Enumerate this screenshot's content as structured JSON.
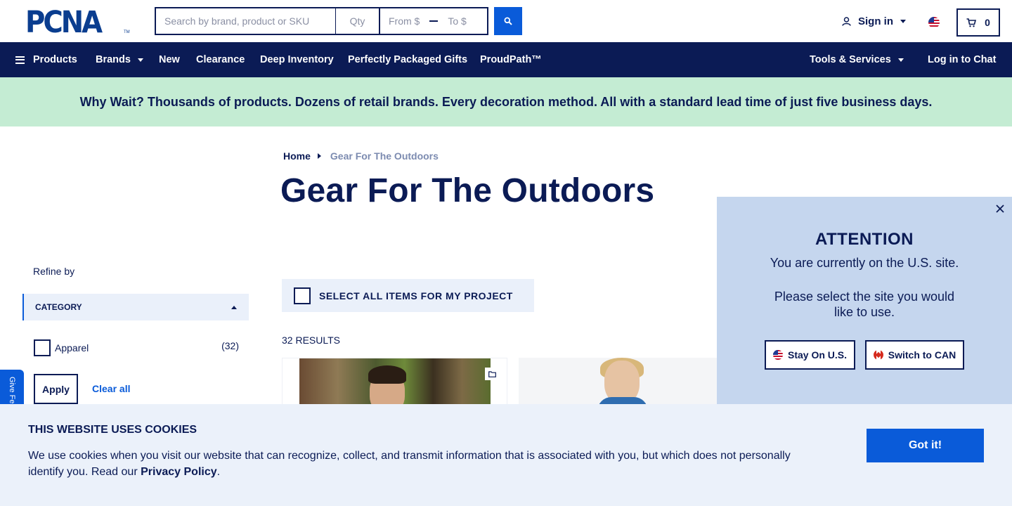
{
  "header": {
    "logo_text": "PCNA",
    "logo_tm": "TM",
    "search_placeholder": "Search by brand, product or SKU",
    "qty_placeholder": "Qty",
    "price_from_placeholder": "From $",
    "price_to_placeholder": "To $",
    "signin_label": "Sign in",
    "cart_count": "0"
  },
  "nav": {
    "products": "Products",
    "brands": "Brands",
    "new": "New",
    "clearance": "Clearance",
    "deep_inventory": "Deep Inventory",
    "gifts": "Perfectly Packaged Gifts",
    "proudpath": "ProudPath™",
    "tools": "Tools & Services",
    "chat": "Log in to Chat"
  },
  "promo": {
    "text": "Why Wait? Thousands of products. Dozens of retail brands. Every decoration method. All with a standard lead time of just five business days."
  },
  "breadcrumb": {
    "home": "Home",
    "current": "Gear For The Outdoors"
  },
  "page": {
    "title": "Gear For The Outdoors",
    "select_all": "SELECT ALL ITEMS FOR MY PROJECT",
    "results": "32 RESULTS"
  },
  "sidebar": {
    "refine_label": "Refine by",
    "category_header": "CATEGORY",
    "facets": [
      {
        "label": "Apparel",
        "count": "(32)"
      }
    ],
    "apply_label": "Apply",
    "clear_label": "Clear all",
    "feedback_label": "Give Feedback"
  },
  "attention": {
    "title": "ATTENTION",
    "message": "You are currently on the U.S. site.",
    "prompt": "Please select the site you would like to use.",
    "stay_label": "Stay On U.S.",
    "switch_label": "Switch to CAN"
  },
  "cookie": {
    "title": "THIS WEBSITE USES COOKIES",
    "text": "We use cookies when you visit our website that can recognize, collect, and transmit information that is associated with you, but which does not personally identify you. Read our",
    "link": "Privacy Policy",
    "period": ".",
    "button": "Got it!"
  },
  "colors": {
    "navy": "#0b1b55",
    "blue": "#0a5bd9",
    "promo_bg": "#c4ecd3",
    "modal_bg": "#c5d6ee",
    "cookie_bg": "#ebf1fa"
  }
}
